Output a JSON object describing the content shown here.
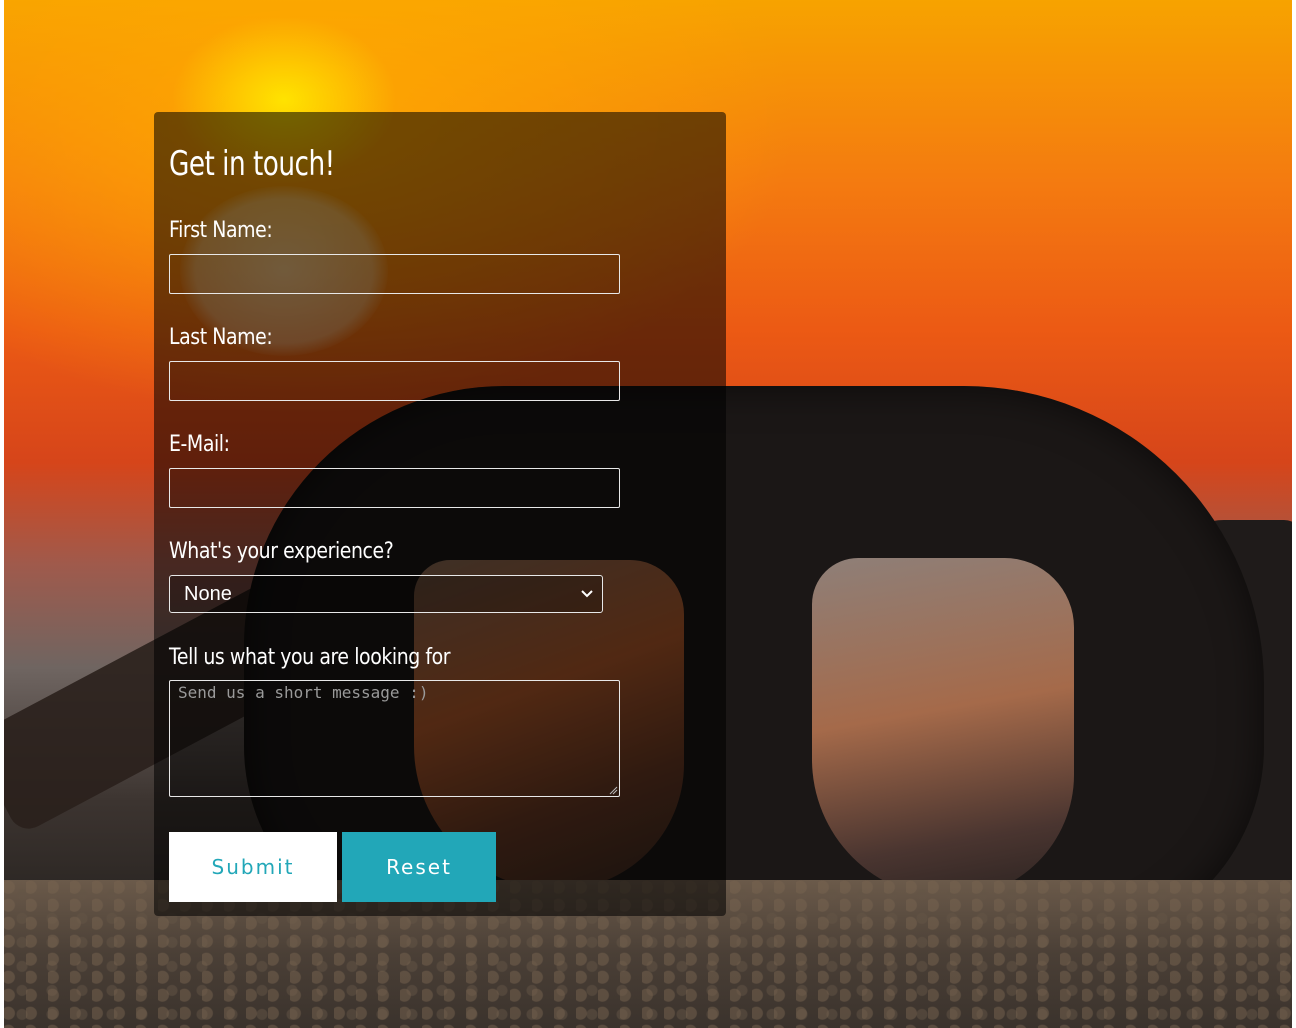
{
  "form": {
    "title": "Get in touch!",
    "first_name_label": "First Name:",
    "first_name_value": "",
    "last_name_label": "Last Name:",
    "last_name_value": "",
    "email_label": "E-Mail:",
    "email_value": "",
    "experience_label": "What's your experience?",
    "experience_selected": "None",
    "message_label": "Tell us what you are looking for",
    "message_placeholder": "Send us a short message :)",
    "submit_label": "Submit",
    "reset_label": "Reset"
  },
  "colors": {
    "accent": "#22a7b8",
    "panel_overlay": "rgba(0,0,0,0.55)",
    "text": "#ffffff"
  },
  "icons": {
    "select_arrow": "chevron-down-icon",
    "resize_handle": "resize-grip-icon"
  }
}
